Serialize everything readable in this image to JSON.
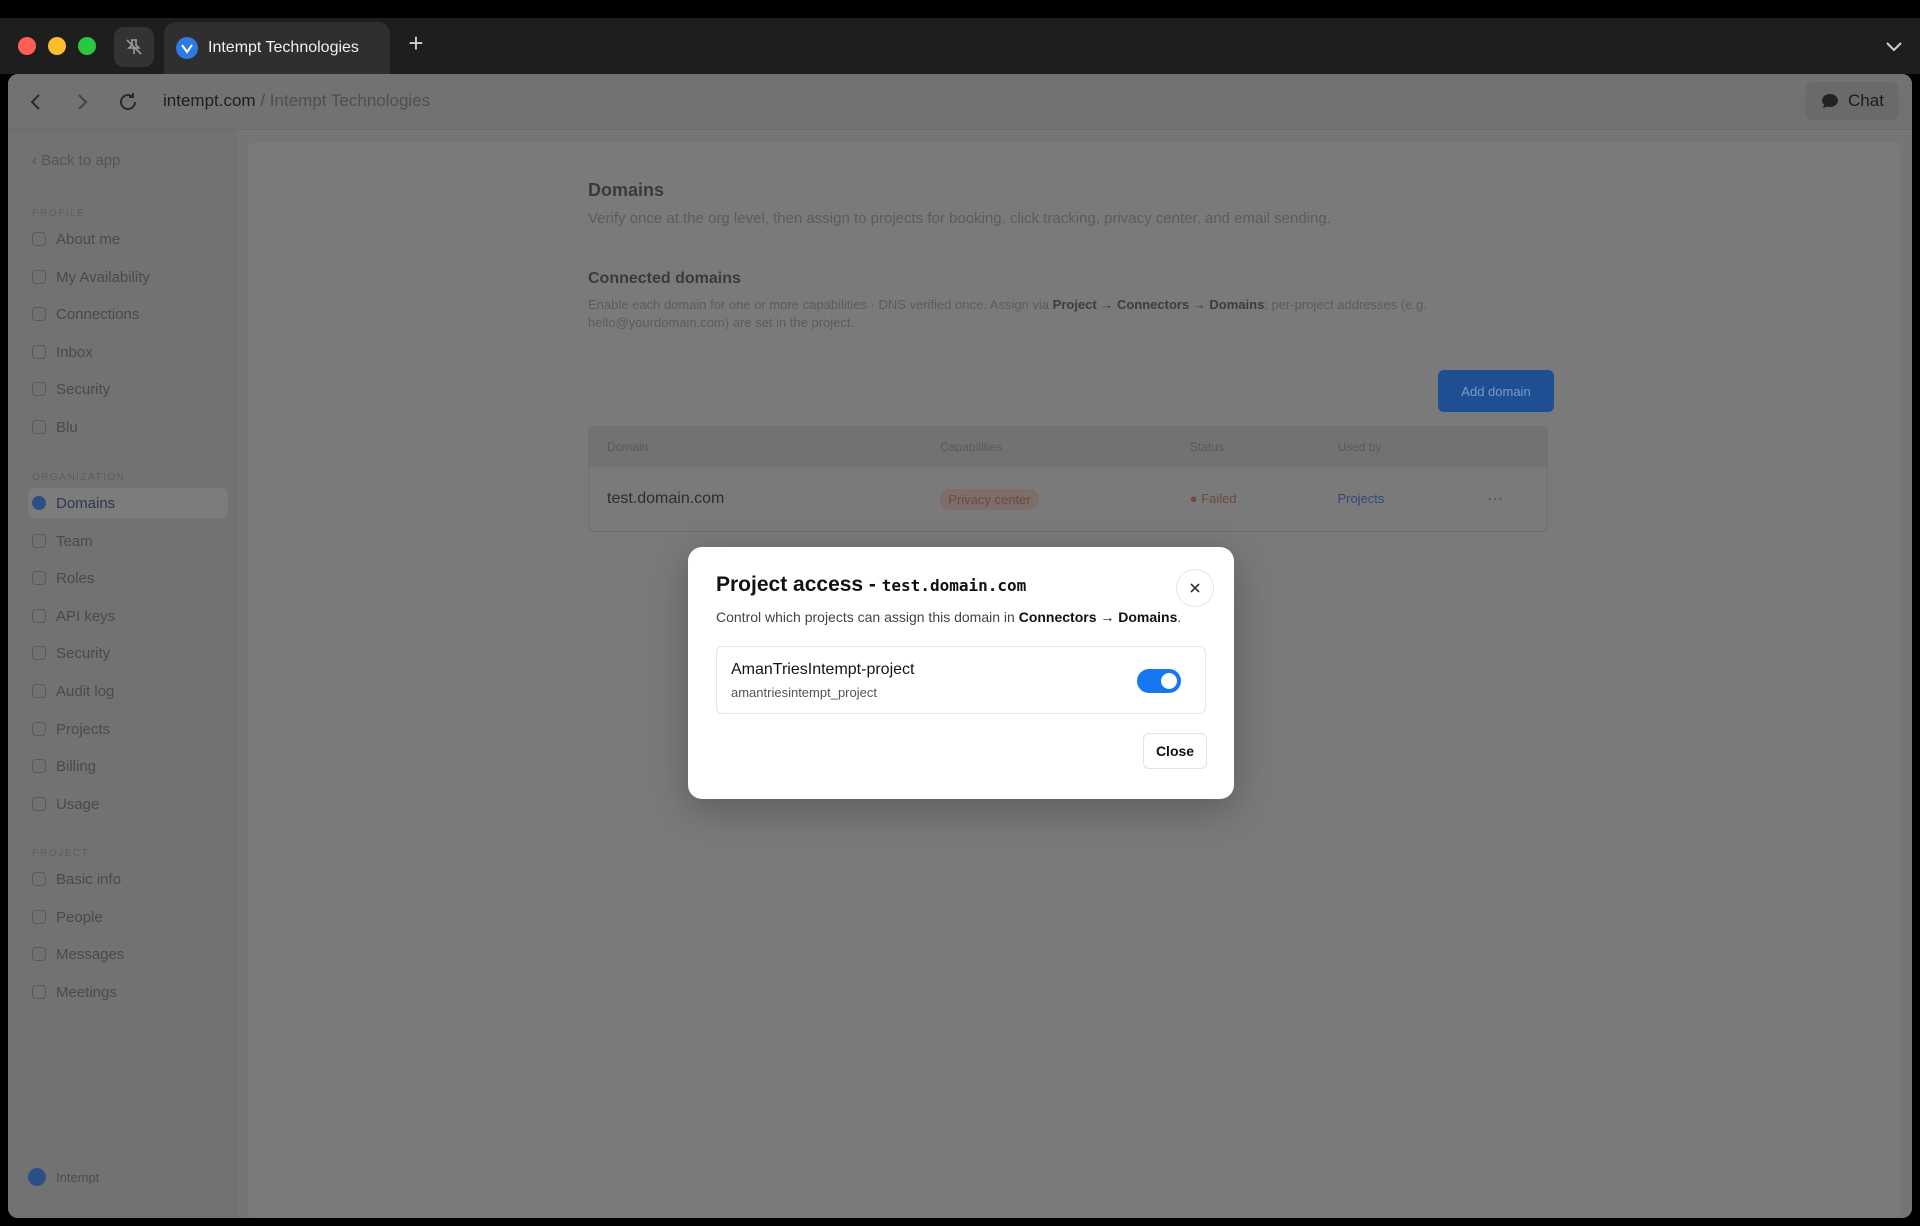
{
  "browser": {
    "tab_title": "Intempt Technologies",
    "url_host": "intempt.com",
    "url_separator": "/",
    "url_path": "Intempt Technologies",
    "chat_label": "Chat"
  },
  "sidebar": {
    "back_label": "Back to app",
    "sections": [
      {
        "title": "PROFILE",
        "items": [
          "About me",
          "My Availability",
          "Connections",
          "Inbox",
          "Security",
          "Blu"
        ]
      },
      {
        "title": "ORGANIZATION",
        "items": [
          "Domains",
          "Team",
          "Roles",
          "API keys",
          "Security",
          "Audit log",
          "Projects",
          "Billing",
          "Usage"
        ]
      },
      {
        "title": "PROJECT",
        "items": [
          "Basic info",
          "People",
          "Messages",
          "Meetings"
        ]
      }
    ],
    "active_item": "Domains",
    "footer_label": "Intempt"
  },
  "domains_page": {
    "title": "Domains",
    "description": "Verify once at the org level, then assign to projects for booking, click tracking, privacy center, and email sending.",
    "connected_title": "Connected domains",
    "connected_desc_1": "Enable each domain for one or more capabilities · DNS verified once. Assign via",
    "connected_desc_bold": "Project → Connectors → Domains",
    "connected_desc_2": "; per-project addresses (e.g. hello@yourdomain.com) are set in the project.",
    "add_button": "Add domain",
    "columns": [
      "Domain",
      "Capabilities",
      "Status",
      "Used by",
      ""
    ],
    "rows": [
      {
        "domain": "test.domain.com",
        "capabilities": "Privacy center",
        "status": "● Failed",
        "used_by": "Projects",
        "menu": "⋯"
      }
    ]
  },
  "modal": {
    "title": "Project access -",
    "title_code": "test.domain.com",
    "desc_prefix": "Control which projects can assign this domain in",
    "desc_bold": "Connectors → Domains",
    "desc_suffix": ".",
    "project_name": "AmanTriesIntempt-project",
    "project_slug": "amantriesintempt_project",
    "toggle_on": true,
    "close_button": "Close"
  },
  "colors": {
    "accent": "#1677f0",
    "traffic_red": "#ff5f57",
    "traffic_yellow": "#febc2e",
    "traffic_green": "#28c840"
  },
  "icons": [
    "pin-off-icon",
    "favicon-icon",
    "plus-icon",
    "chevron-down-icon",
    "back-arrow-icon",
    "forward-arrow-icon",
    "reload-icon",
    "chat-bubble-icon",
    "close-icon"
  ]
}
